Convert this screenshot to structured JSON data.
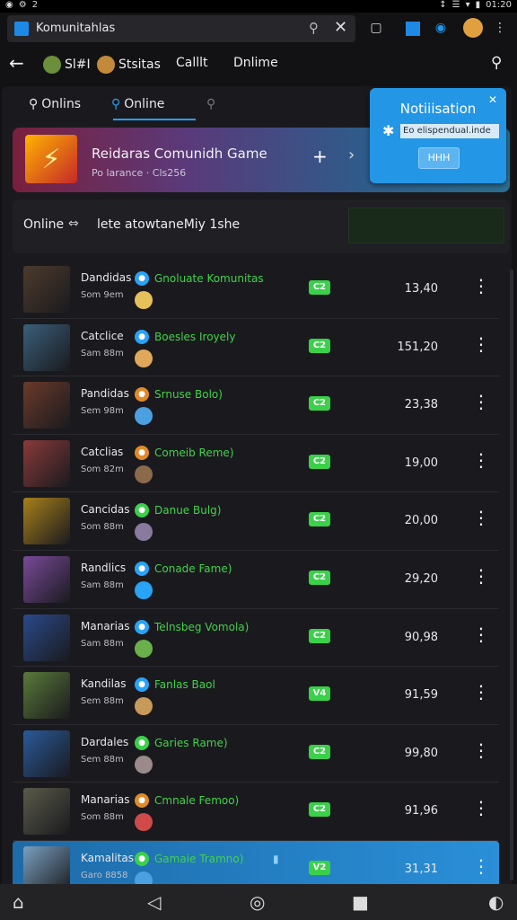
{
  "status_bar": {
    "left_icons": [
      "◉",
      "⚙",
      "2"
    ],
    "right_icons": [
      "↕",
      "☰",
      "▾",
      "▮"
    ],
    "clock": "01:20"
  },
  "address_bar": {
    "title": "Komunitahlas"
  },
  "navbar": {
    "items": [
      {
        "label": "Sl#I",
        "avatar_color": "#6b8f3a"
      },
      {
        "label": "Stsitas",
        "avatar_color": "#c28a3a"
      },
      {
        "label": "Calllt"
      },
      {
        "label": "Dnlime"
      }
    ]
  },
  "tabs": [
    {
      "label": "Onlins"
    },
    {
      "label": "Online"
    },
    {
      "label": ""
    }
  ],
  "banner": {
    "title": "Reidaras Comunidh Game",
    "subtitle": "Po larance · Cls256"
  },
  "notification": {
    "title": "Notiiisation",
    "body": "Eo elispendual.inde",
    "button_label": "HHH"
  },
  "filter": {
    "label": "Online",
    "description": "lete atowtaneMiy 1she"
  },
  "rows": [
    {
      "name": "Dandidas",
      "sub": "Som 9em",
      "game": "Gnoluate Komunitas",
      "badge": "C2",
      "value": "13,40",
      "thumb": "#4d3b2d",
      "icon1": "#29a3f5",
      "icon2": "#e6c15a"
    },
    {
      "name": "Catclice",
      "sub": "Sam 88m",
      "game": "Boesles Iroyely",
      "badge": "C2",
      "value": "151,20",
      "thumb": "#3a5f7a",
      "icon1": "#29a3f5",
      "icon2": "#e0a85a"
    },
    {
      "name": "Pandidas",
      "sub": "Sem 98m",
      "game": "Srnuse Bolo)",
      "badge": "C2",
      "value": "23,38",
      "thumb": "#6b3a2a",
      "icon1": "#e08a2a",
      "icon2": "#4aa0e0"
    },
    {
      "name": "Catclias",
      "sub": "Som 82m",
      "game": "Comeib Reme)",
      "badge": "C2",
      "value": "19,00",
      "thumb": "#8a3a3a",
      "icon1": "#e08a2a",
      "icon2": "#8a6a4a"
    },
    {
      "name": "Cancidas",
      "sub": "Som 88m",
      "game": "Danue Bulg)",
      "badge": "C2",
      "value": "20,00",
      "thumb": "#a8801a",
      "icon1": "#3bd04a",
      "icon2": "#8a7aa0"
    },
    {
      "name": "Randlics",
      "sub": "Sam 88m",
      "game": "Conade Fame)",
      "badge": "C2",
      "value": "29,20",
      "thumb": "#7a4a9a",
      "icon1": "#29a3f5",
      "icon2": "#29a3f5"
    },
    {
      "name": "Manarias",
      "sub": "Sam 88m",
      "game": "Telnsbeg Vomola)",
      "badge": "C2",
      "value": "90,98",
      "thumb": "#2a4a8a",
      "icon1": "#29a3f5",
      "icon2": "#6ab04a"
    },
    {
      "name": "Kandilas",
      "sub": "Sem 88m",
      "game": "Fanlas Baol",
      "badge": "V4",
      "value": "91,59",
      "thumb": "#5a7a3a",
      "icon1": "#29a3f5",
      "icon2": "#c89a5a"
    },
    {
      "name": "Dardales",
      "sub": "Sem 88m",
      "game": "Garies Rame)",
      "badge": "C2",
      "value": "99,80",
      "thumb": "#2a5a9a",
      "icon1": "#3bd04a",
      "icon2": "#9a8a8a"
    },
    {
      "name": "Manarias",
      "sub": "Som 88m",
      "game": "Cmnale Femoo)",
      "badge": "C2",
      "value": "91,96",
      "thumb": "#5a5a4a",
      "icon1": "#e08a2a",
      "icon2": "#d04a4a"
    },
    {
      "name": "Kamalitas",
      "sub": "Garo 8858",
      "game": "Gamaie Tramno)",
      "badge": "V2",
      "value": "31,31",
      "thumb": "#7aa0c0",
      "icon1": "#3bd04a",
      "icon2": "#4aa0e0",
      "selected": true
    }
  ]
}
